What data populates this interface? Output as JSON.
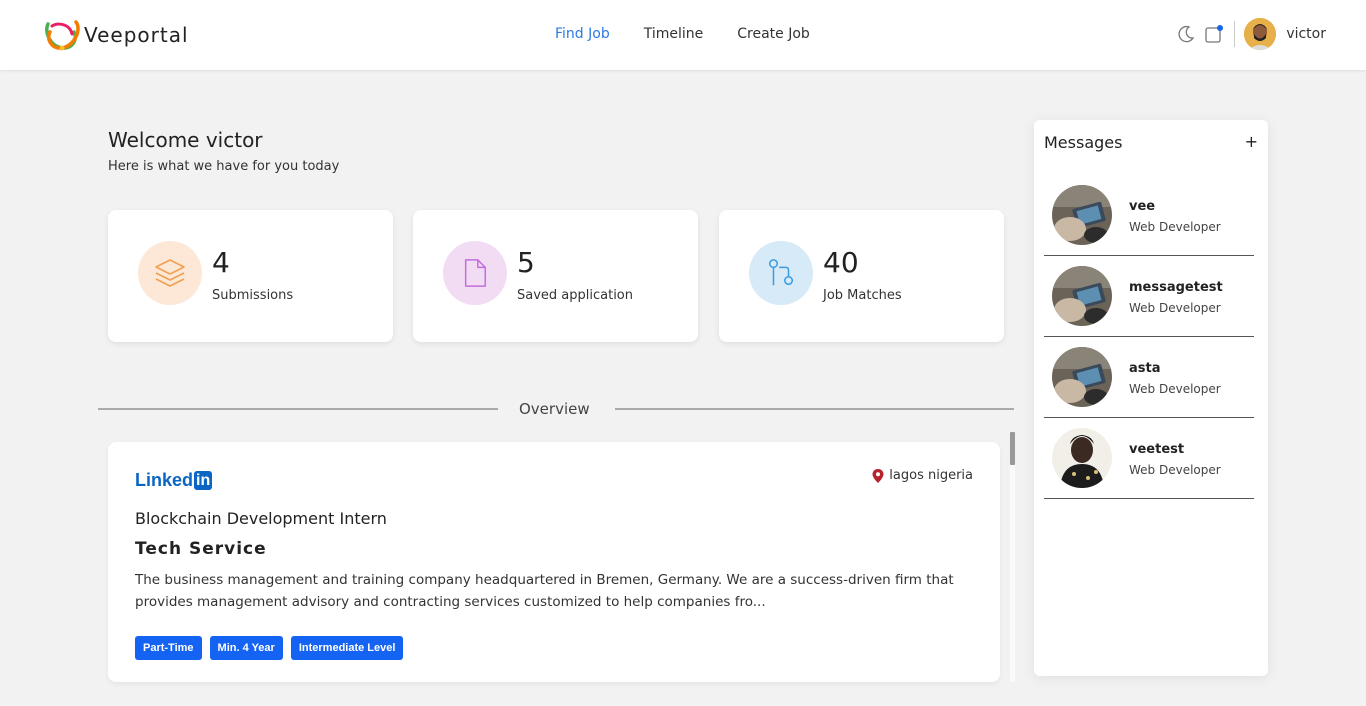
{
  "brand": {
    "name": "Veeportal"
  },
  "nav": {
    "links": [
      "Find Job",
      "Timeline",
      "Create Job"
    ],
    "active": "Find Job"
  },
  "user": {
    "name": "victor"
  },
  "welcome": {
    "title": "Welcome victor",
    "subtitle": "Here is what we have for you today"
  },
  "stats": [
    {
      "value": "4",
      "label": "Submissions",
      "icon": "layers-icon",
      "color": "#f5a05a"
    },
    {
      "value": "5",
      "label": "Saved application",
      "icon": "file-icon",
      "color": "#c56de0"
    },
    {
      "value": "40",
      "label": "Job Matches",
      "icon": "git-pull-icon",
      "color": "#3c9be0"
    }
  ],
  "overview": {
    "title": "Overview"
  },
  "job": {
    "source": "Linked",
    "source_badge": "in",
    "location": "lagos nigeria",
    "title": "Blockchain Development Intern",
    "company": "Tech Service",
    "description": "The business management and training company headquartered in Bremen, Germany. We are a success-driven firm that provides management advisory and contracting services customized to help companies fro...",
    "tags": [
      "Part-Time",
      "Min. 4 Year",
      "Intermediate Level"
    ]
  },
  "messages": {
    "title": "Messages",
    "add_label": "+",
    "items": [
      {
        "name": "vee",
        "role": "Web Developer"
      },
      {
        "name": "messagetest",
        "role": "Web Developer"
      },
      {
        "name": "asta",
        "role": "Web Developer"
      },
      {
        "name": "veetest",
        "role": "Web Developer"
      }
    ]
  },
  "colors": {
    "accent": "#2b7be4",
    "tag": "#1463f3",
    "linkedin": "#0a66c2",
    "location_pin": "#b8232f"
  }
}
